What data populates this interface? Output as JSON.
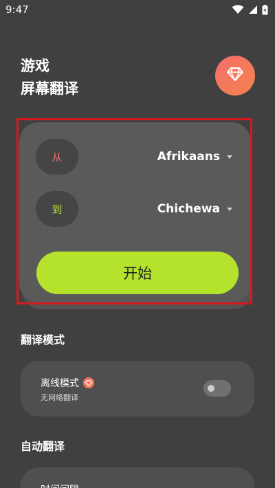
{
  "status_bar": {
    "time": "9:47",
    "icons": [
      "wifi-icon",
      "signal-icon",
      "battery-charging-icon"
    ]
  },
  "header": {
    "title_line1": "游戏",
    "title_line2": "屏幕翻译",
    "premium_icon": "gem-icon"
  },
  "language_card": {
    "from_label": "从",
    "from_language": "Afrikaans",
    "to_label": "到",
    "to_language": "Chichewa",
    "start_label": "开始"
  },
  "translation_mode": {
    "section_title": "翻译模式",
    "offline_label": "离线模式",
    "offline_description": "无网络翻译",
    "offline_enabled": false
  },
  "auto_translate": {
    "section_title": "自动翻译",
    "interval_label": "时间间隔"
  },
  "colors": {
    "background": "#404040",
    "accent_green": "#b5e32c",
    "accent_red": "#f26b6b",
    "highlight_frame": "#d7191f"
  }
}
